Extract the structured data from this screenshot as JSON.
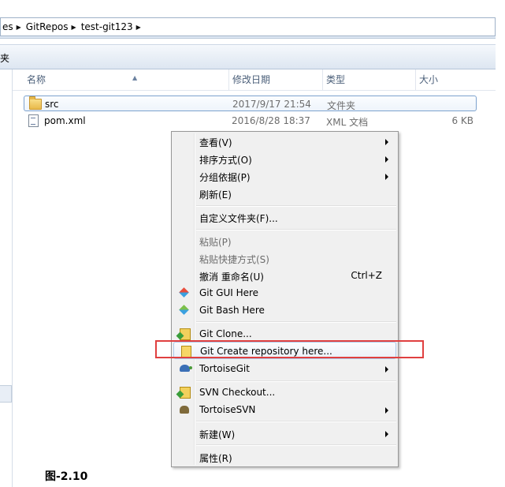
{
  "address_bar": {
    "crumbs": [
      "es",
      "GitRepos",
      "test-git123"
    ]
  },
  "toolbar": {
    "label": "夹"
  },
  "columns": {
    "name": "名称",
    "modified": "修改日期",
    "type": "类型",
    "size": "大小"
  },
  "files": [
    {
      "name": "src",
      "modified": "2017/9/17 21:54",
      "type": "文件夹",
      "size": "",
      "icon": "folder-icon"
    },
    {
      "name": "pom.xml",
      "modified": "2016/8/28 18:37",
      "type": "XML 文档",
      "size": "6 KB",
      "icon": "xml-file-icon"
    }
  ],
  "context_menu": {
    "view": "查看(V)",
    "sort": "排序方式(O)",
    "group": "分组依据(P)",
    "refresh": "刷新(E)",
    "customize": "自定义文件夹(F)...",
    "paste": "粘贴(P)",
    "paste_shortcut": "粘贴快捷方式(S)",
    "undo_rename": "撤消 重命名(U)",
    "undo_shortcut": "Ctrl+Z",
    "git_gui": "Git GUI Here",
    "git_bash": "Git Bash Here",
    "git_clone": "Git Clone...",
    "git_create": "Git Create repository here...",
    "tortoisegit": "TortoiseGit",
    "svn_checkout": "SVN Checkout...",
    "tortoisesvn": "TortoiseSVN",
    "new": "新建(W)",
    "properties": "属性(R)"
  },
  "highlight_color": "#e04040",
  "caption": "图-2.10"
}
